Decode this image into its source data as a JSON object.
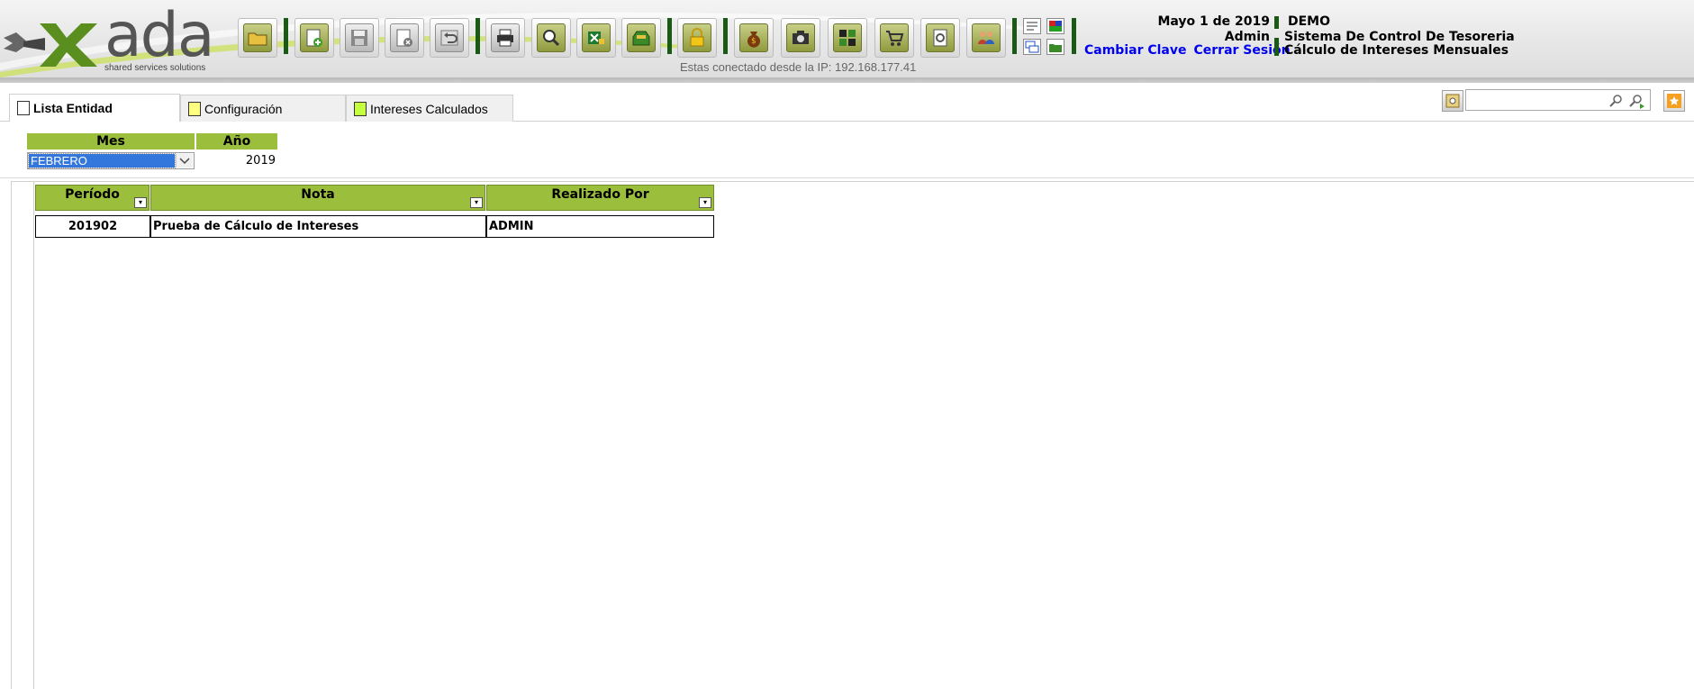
{
  "header": {
    "logo_text": "ada",
    "logo_tagline": "shared services solutions",
    "connection_text": "Estas conectado desde la IP: 192.168.177.41",
    "date": "Mayo 1 de 2019",
    "user": "Admin",
    "change_password": "Cambiar Clave",
    "logout": "Cerrar Sesión",
    "company": "DEMO",
    "system_name": "Sistema De Control De Tesoreria",
    "module_name": "Cálculo de Intereses Mensuales"
  },
  "toolbar": {
    "buttons": [
      {
        "name": "open-folder",
        "icon": "folder-icon"
      },
      {
        "name": "new",
        "icon": "new-document-icon"
      },
      {
        "name": "save",
        "icon": "save-icon"
      },
      {
        "name": "delete",
        "icon": "delete-icon"
      },
      {
        "name": "undo",
        "icon": "undo-icon"
      },
      {
        "name": "print",
        "icon": "printer-icon"
      },
      {
        "name": "preview",
        "icon": "magnifier-icon"
      },
      {
        "name": "export-excel",
        "icon": "excel-icon"
      },
      {
        "name": "inbox",
        "icon": "inbox-icon"
      },
      {
        "name": "lock",
        "icon": "lock-icon"
      },
      {
        "name": "money",
        "icon": "money-bag-icon"
      },
      {
        "name": "camera",
        "icon": "camera-icon"
      },
      {
        "name": "grid",
        "icon": "grid-icon"
      },
      {
        "name": "cart",
        "icon": "cart-icon"
      },
      {
        "name": "settings",
        "icon": "settings-icon"
      },
      {
        "name": "users",
        "icon": "users-icon"
      }
    ]
  },
  "tabs": [
    {
      "label": "Lista Entidad",
      "active": true
    },
    {
      "label": "Configuración",
      "active": false
    },
    {
      "label": "Intereses Calculados",
      "active": false
    }
  ],
  "filter": {
    "month_label": "Mes",
    "year_label": "Año",
    "month_value": "FEBRERO",
    "year_value": "2019"
  },
  "grid": {
    "columns": [
      "Período",
      "Nota",
      "Realizado Por"
    ],
    "rows": [
      {
        "periodo": "201902",
        "nota": "Prueba de Cálculo de Intereses",
        "realizado_por": "ADMIN"
      }
    ]
  },
  "colors": {
    "accent_green": "#9bbf3d",
    "separator_green": "#1a5a14",
    "link_blue": "#0000ee",
    "selection_blue": "#3377dd"
  }
}
